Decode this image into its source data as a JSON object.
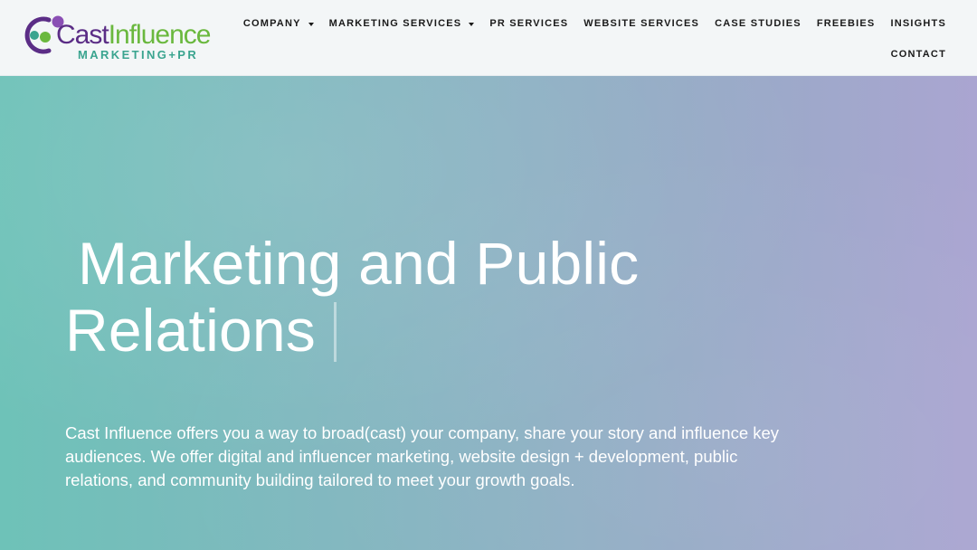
{
  "brand": {
    "name_part1": "Cast",
    "name_part2": "Influence",
    "tagline": "MARKETING+PR",
    "colors": {
      "purple": "#5b2d86",
      "green": "#6ab83e",
      "teal": "#3aa48f"
    }
  },
  "nav": {
    "row1": [
      {
        "label": "COMPANY",
        "has_dropdown": true
      },
      {
        "label": "MARKETING SERVICES",
        "has_dropdown": true
      },
      {
        "label": "PR SERVICES",
        "has_dropdown": false
      },
      {
        "label": "WEBSITE SERVICES",
        "has_dropdown": false
      },
      {
        "label": "CASE STUDIES",
        "has_dropdown": false
      },
      {
        "label": "FREEBIES",
        "has_dropdown": false
      },
      {
        "label": "INSIGHTS",
        "has_dropdown": false
      }
    ],
    "row2": [
      {
        "label": "CONTACT",
        "has_dropdown": false
      }
    ]
  },
  "hero": {
    "title_line1": "Marketing and Public",
    "title_line2": "Relations",
    "body": "Cast Influence offers you a way to broad(cast) your company, share your story and influence key audiences. We offer digital and influencer marketing, website design + development, public relations, and community building tailored to meet your growth goals.",
    "gradient_colors": [
      "#6ec2b8",
      "#84b5c0",
      "#96abc6",
      "#aaa5d1"
    ]
  }
}
